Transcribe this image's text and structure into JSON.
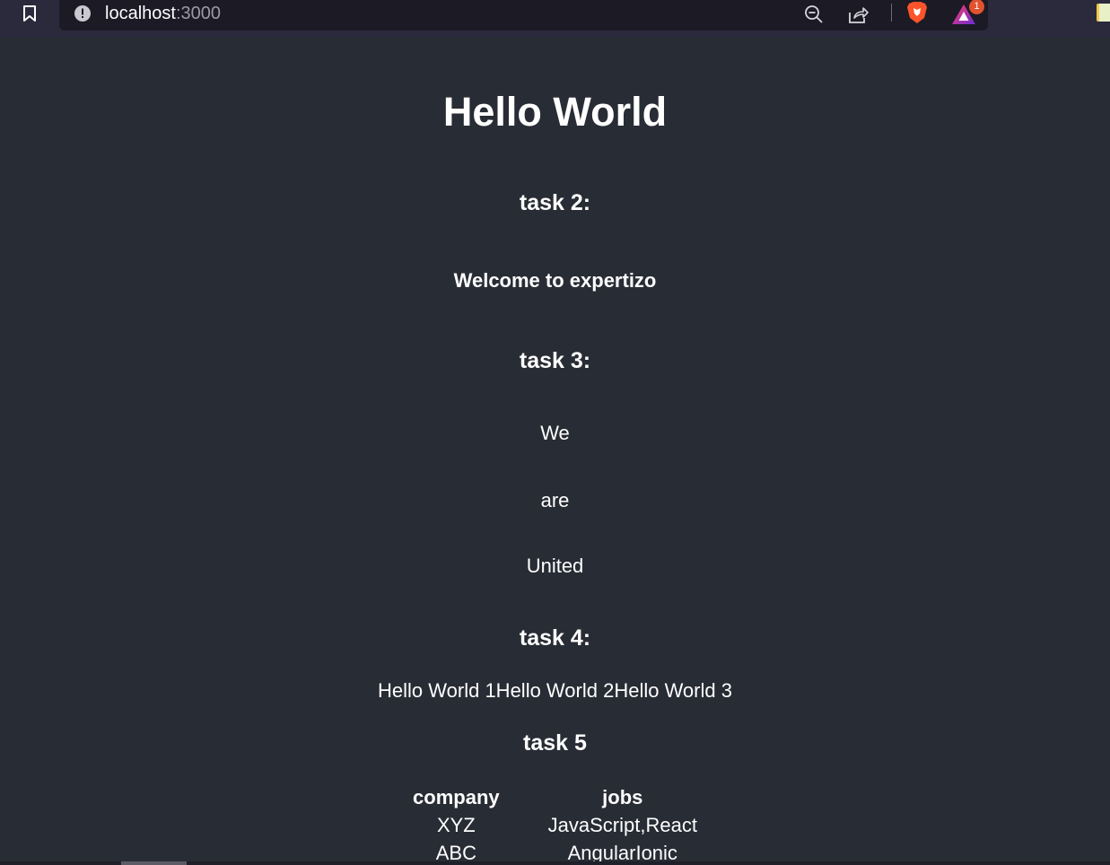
{
  "browser": {
    "url_host": "localhost",
    "url_port": ":3000",
    "rewards_badge_count": "1",
    "icons": {
      "bookmark": "bookmark-icon",
      "site_info": "info-icon",
      "zoom": "zoom-out-icon",
      "share": "share-icon",
      "shields": "brave-shields-icon",
      "rewards": "brave-rewards-icon",
      "extension": "extension-icon"
    }
  },
  "page": {
    "title": "Hello World",
    "task2": {
      "heading": "task 2:",
      "text": "Welcome to expertizo"
    },
    "task3": {
      "heading": "task 3:",
      "words": [
        "We",
        "are",
        "United"
      ]
    },
    "task4": {
      "heading": "task 4:",
      "text": "Hello World 1Hello World 2Hello World 3"
    },
    "task5": {
      "heading": "task 5",
      "table": {
        "headers": [
          "company",
          "jobs"
        ],
        "rows": [
          [
            "XYZ",
            "JavaScript,React"
          ],
          [
            "ABC",
            "AngularIonic"
          ]
        ]
      }
    }
  }
}
